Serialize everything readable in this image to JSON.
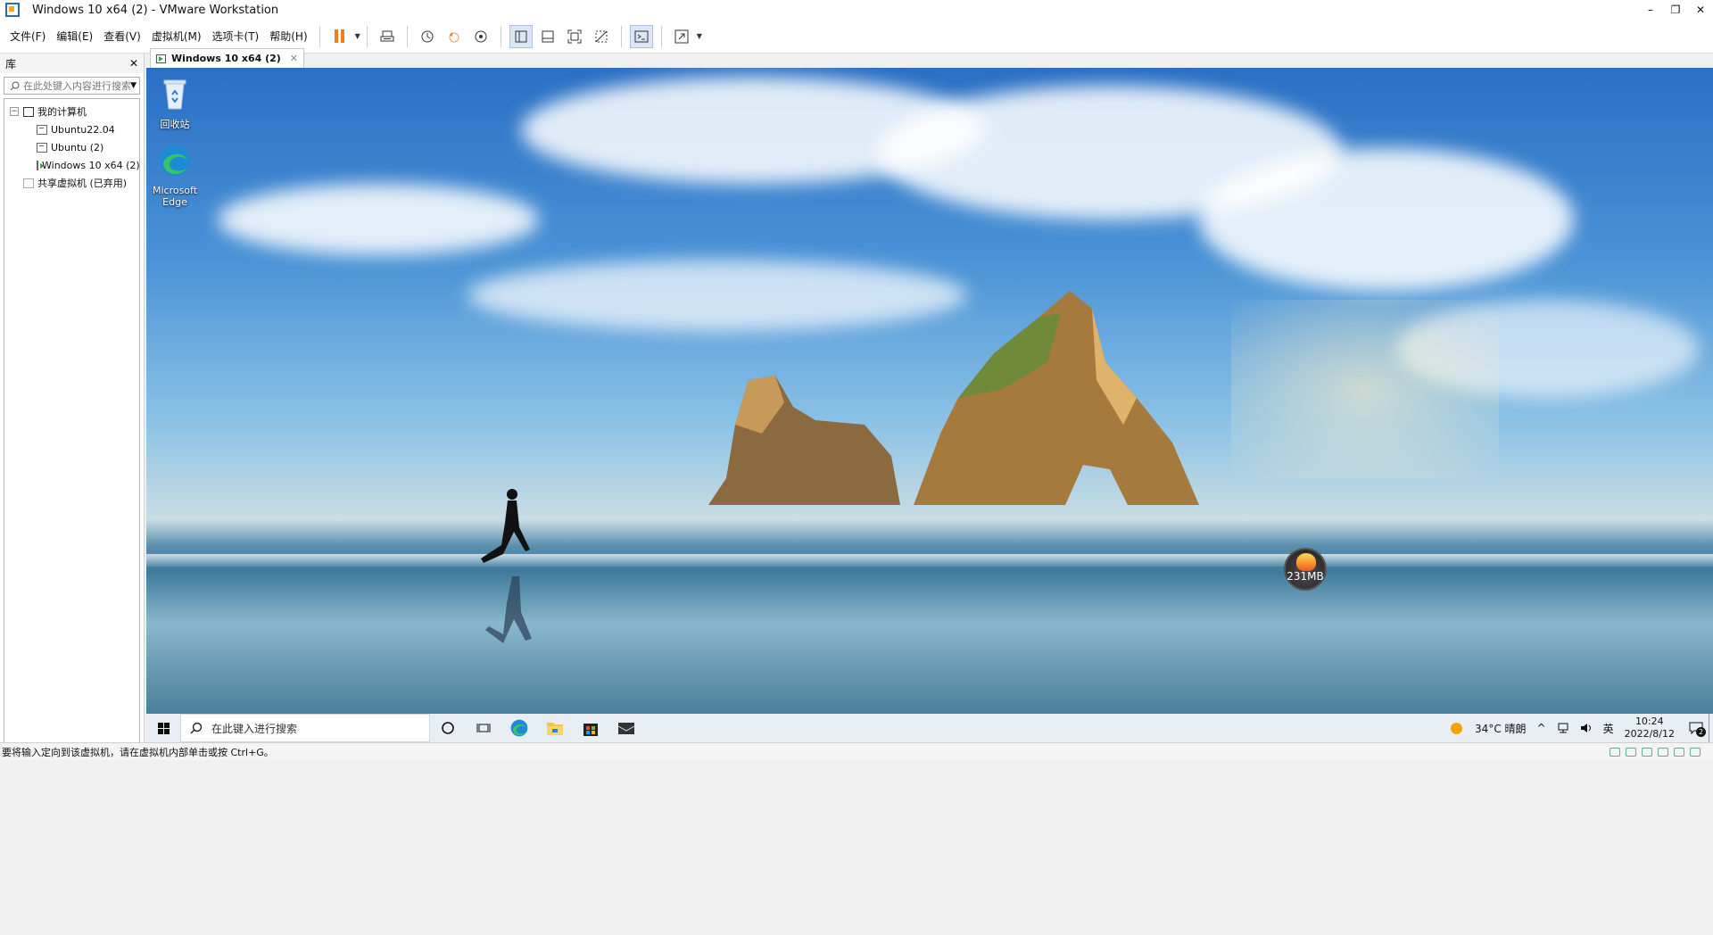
{
  "window": {
    "title": "Windows 10 x64 (2) - VMware Workstation",
    "controls": {
      "minimize": "–",
      "restore": "❐",
      "close": "✕"
    }
  },
  "menu": [
    "文件(F)",
    "编辑(E)",
    "查看(V)",
    "虚拟机(M)",
    "选项卡(T)",
    "帮助(H)"
  ],
  "toolbar": {
    "icons": [
      "pause-icon",
      "send-ctrl-alt-del-icon",
      "snapshot-icon",
      "revert-snapshot-icon",
      "snapshot-manager-icon",
      "show-library-icon",
      "thumbnail-bar-icon",
      "full-screen-icon",
      "unity-icon",
      "console-view-icon",
      "stretch-icon"
    ],
    "accent": "#f47c20"
  },
  "library": {
    "header": "库",
    "close": "✕",
    "search_placeholder": "在此处键入内容进行搜索",
    "tree": {
      "root": "我的计算机",
      "items": [
        "Ubuntu22.04",
        "Ubuntu (2)",
        "Windows 10 x64 (2)"
      ],
      "shared": "共享虚拟机 (已弃用)"
    }
  },
  "tab": {
    "label": "Windows 10 x64 (2)",
    "close": "✕"
  },
  "desktop": {
    "icons": [
      {
        "label": "回收站",
        "icon": "recycle-bin-icon"
      },
      {
        "label": "Microsoft Edge",
        "icon": "edge-icon"
      }
    ],
    "memory_badge": "231MB"
  },
  "taskbar": {
    "search_placeholder": "在此键入进行搜索",
    "apps": [
      "cortana-icon",
      "task-view-icon",
      "edge-icon",
      "file-explorer-icon",
      "store-icon",
      "mail-icon"
    ],
    "weather": "34°C 晴朗",
    "tray_chevron": "^",
    "ime": "英",
    "time": "10:24",
    "date": "2022/8/12",
    "notification_count": "2"
  },
  "statusbar": {
    "message": "要将输入定向到该虚拟机，请在虚拟机内部单击或按 Ctrl+G。"
  }
}
